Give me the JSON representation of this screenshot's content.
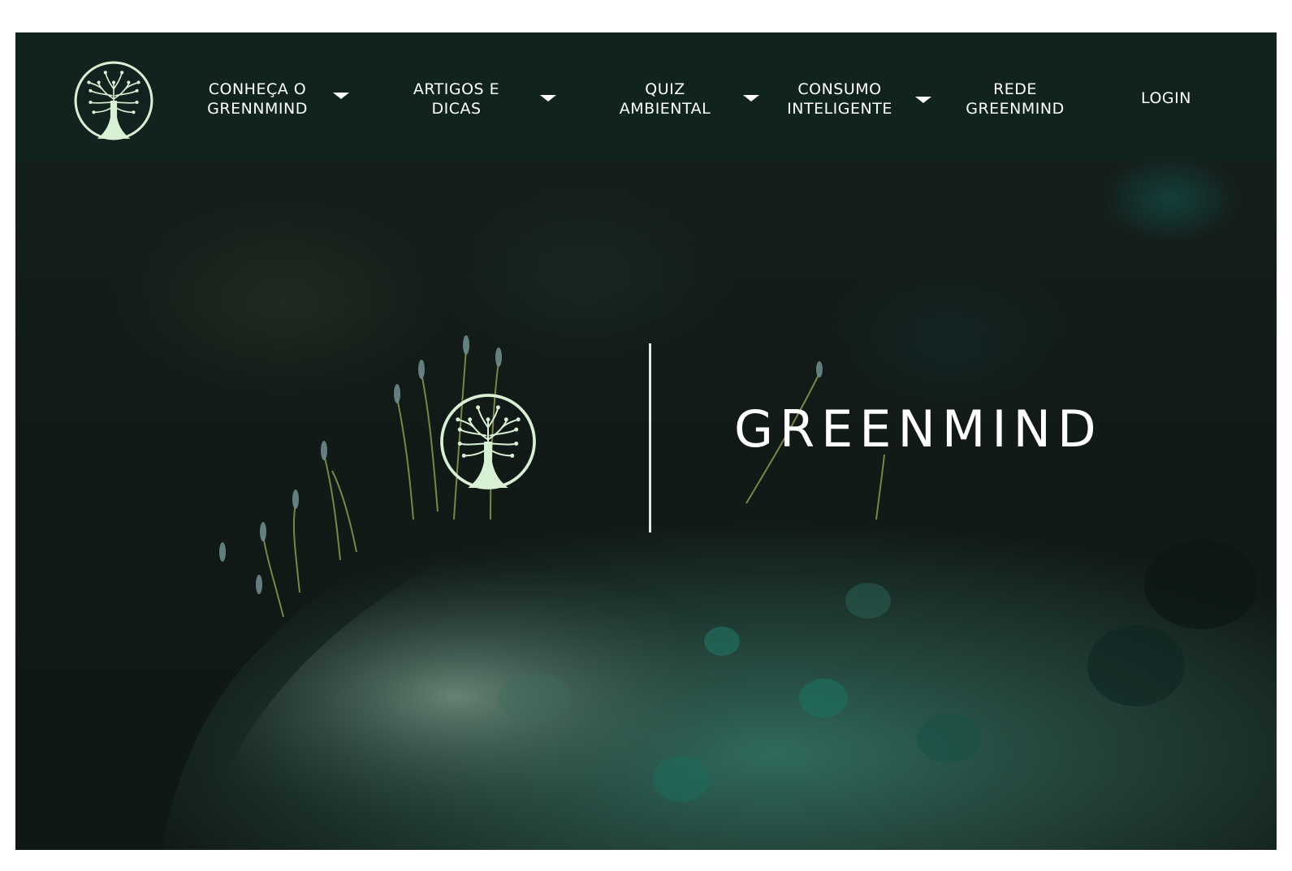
{
  "brand": {
    "logo_icon": "tree-of-life-circle-icon",
    "name": "GREENMIND",
    "accent_color": "#d8f0d4",
    "nav_background": "#102420"
  },
  "nav": {
    "items": [
      {
        "line1": "CONHEÇA O",
        "line2": "GRENNMIND",
        "has_dropdown": true
      },
      {
        "line1": "ARTIGOS E",
        "line2": "DICAS",
        "has_dropdown": true
      },
      {
        "line1": "QUIZ",
        "line2": "AMBIENTAL",
        "has_dropdown": true
      },
      {
        "line1": "CONSUMO",
        "line2": "INTELIGENTE",
        "has_dropdown": true
      },
      {
        "line1": "REDE",
        "line2": "GREENMIND",
        "has_dropdown": false
      }
    ],
    "dropdown_icon": "caret-down-icon",
    "login_label": "LOGIN"
  },
  "hero": {
    "title": "GREENMIND",
    "logo_icon": "tree-of-life-circle-icon",
    "background": "moss-macro-photo"
  }
}
